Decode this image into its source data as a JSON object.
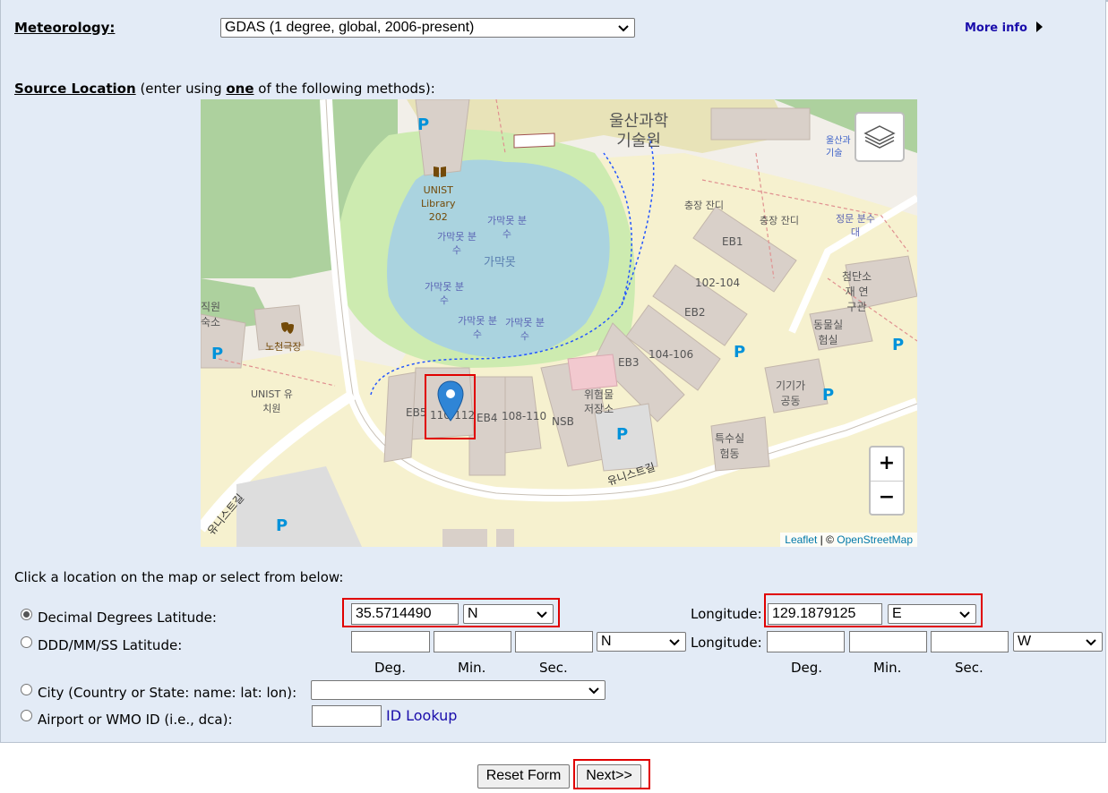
{
  "meteorology": {
    "label": "Meteorology:",
    "selected": "GDAS (1 degree, global, 2006-present)",
    "more_info": "More info"
  },
  "source_location": {
    "label": "Source Location",
    "hint_pre": "(enter using ",
    "hint_em": "one",
    "hint_post": " of the following methods):"
  },
  "map": {
    "labels": {
      "library": [
        "UNIST",
        "Library",
        "202"
      ],
      "science_museum": [
        "울산과학",
        "기술원"
      ],
      "lake": "가막못",
      "fountain_a": [
        "가막못 분",
        "수"
      ],
      "fountain_b": [
        "가막못 분",
        "수"
      ],
      "fountain_c": [
        "가막못 분",
        "수"
      ],
      "fountain_d": [
        "가막못 분",
        "수"
      ],
      "fountain_e": [
        "가막못 분",
        "수"
      ],
      "lawn_a": "충장 잔디",
      "lawn_b": "충장 잔디",
      "eb1": "EB1",
      "b102_104": "102-104",
      "eb2": "EB2",
      "b104_106": "104-106",
      "eb3": "EB3",
      "eb4": "EB4",
      "b108_110": "108-110",
      "nsb": "NSB",
      "eb5": "EB5",
      "b110_112": "110-112",
      "hazard": [
        "위험물",
        "저장소"
      ],
      "fountain_plaza": [
        "정문 분수",
        "대"
      ],
      "advanced": [
        "첨단소",
        "재 연",
        "구관"
      ],
      "animal": [
        "동물실",
        "험실"
      ],
      "machine": [
        "기기가",
        "공동"
      ],
      "special": [
        "특수실",
        "험동"
      ],
      "open_theater": "노천극장",
      "staff": [
        "직원",
        "숙소"
      ],
      "kinder": [
        "UNIST 유",
        "치원"
      ],
      "road_a": "유니스트길",
      "road_b": "유니스트길",
      "bus_stop": [
        "울산과",
        "기술"
      ],
      "parking": "P"
    },
    "zoom_in": "+",
    "zoom_out": "−",
    "attribution_leaflet": "Leaflet",
    "attribution_sep": " | © ",
    "attribution_osm": "OpenStreetMap"
  },
  "instructions": "Click a location on the map or select from below:",
  "decimal": {
    "label": "Decimal Degrees Latitude:",
    "lat_value": "35.5714490",
    "lat_dir": "N",
    "lon_label": "Longitude:",
    "lon_value": "129.1879125",
    "lon_dir": "E"
  },
  "dms": {
    "label": "DDD/MM/SS Latitude:",
    "lat_dir": "N",
    "lon_label": "Longitude:",
    "lon_dir": "W",
    "deg": "Deg.",
    "min": "Min.",
    "sec": "Sec."
  },
  "city": {
    "label": "City (Country or State: name: lat: lon):",
    "selected": ""
  },
  "airport": {
    "label": "Airport or WMO ID (i.e., dca):",
    "value": "",
    "lookup": "ID Lookup"
  },
  "buttons": {
    "reset": "Reset Form",
    "next": "Next>>"
  },
  "colors": {
    "panel_bg": "#e3ebf6",
    "highlight": "#e00000",
    "link": "#1a0dab",
    "lake": "#aad3df",
    "park": "#cdebb0",
    "building": "#d9d0c9"
  }
}
